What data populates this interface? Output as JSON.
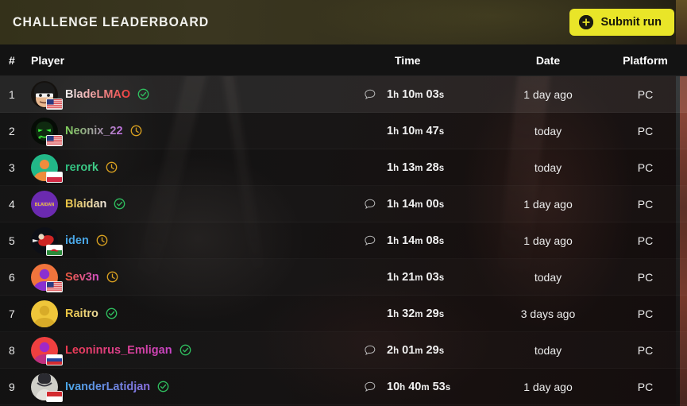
{
  "header": {
    "title": "CHALLENGE LEADERBOARD",
    "submit_label": "Submit run",
    "submit_icon": "plus-circle-icon",
    "accent_color": "#e9e528",
    "bar_background": "#35311c"
  },
  "columns": {
    "rank": "#",
    "player": "Player",
    "time": "Time",
    "date": "Date",
    "platform": "Platform"
  },
  "status_colors": {
    "verified": "#2fbf5f",
    "pending": "#d8a020"
  },
  "rows": [
    {
      "rank": "1",
      "player": "BladeLMAO",
      "name_gradient": [
        "#f2f2f2",
        "#ef3b3b"
      ],
      "status": "verified",
      "status_icon": "verified-check-icon",
      "flag": "us",
      "avatar_style": "photo-dark",
      "has_comment": true,
      "comment_icon": "comment-bubble-icon",
      "time": "1h 10m 03s",
      "date": "1 day ago",
      "platform": "PC",
      "highlighted": true
    },
    {
      "rank": "2",
      "player": "Neonix_22",
      "name_gradient": [
        "#7fcf5a",
        "#c06fe0"
      ],
      "status": "pending",
      "status_icon": "pending-clock-icon",
      "flag": "us",
      "avatar_style": "neon-green",
      "has_comment": false,
      "comment_icon": "",
      "time": "1h 10m 47s",
      "date": "today",
      "platform": "PC",
      "highlighted": false
    },
    {
      "rank": "3",
      "player": "rerork",
      "name_gradient": [
        "#2fbf7f",
        "#43d08a"
      ],
      "status": "pending",
      "status_icon": "pending-clock-icon",
      "flag": "pl",
      "avatar_style": "teal-person",
      "has_comment": false,
      "comment_icon": "",
      "time": "1h 13m 28s",
      "date": "today",
      "platform": "PC",
      "highlighted": false
    },
    {
      "rank": "4",
      "player": "Blaidan",
      "name_gradient": [
        "#e8c13c",
        "#f0e8e0"
      ],
      "status": "verified",
      "status_icon": "verified-check-icon",
      "flag": "",
      "avatar_style": "purple-logo",
      "has_comment": true,
      "comment_icon": "comment-bubble-icon",
      "time": "1h 14m 00s",
      "date": "1 day ago",
      "platform": "PC",
      "highlighted": false
    },
    {
      "rank": "5",
      "player": "iden",
      "name_gradient": [
        "#4aa8e8",
        "#4aa8e8"
      ],
      "status": "pending",
      "status_icon": "pending-clock-icon",
      "flag": "wales",
      "avatar_style": "dark-red-art",
      "has_comment": true,
      "comment_icon": "comment-bubble-icon",
      "time": "1h 14m 08s",
      "date": "1 day ago",
      "platform": "PC",
      "highlighted": false
    },
    {
      "rank": "6",
      "player": "Sev3n",
      "name_gradient": [
        "#ef5a3c",
        "#d050c8"
      ],
      "status": "pending",
      "status_icon": "pending-clock-icon",
      "flag": "us",
      "avatar_style": "orange-purple",
      "has_comment": false,
      "comment_icon": "",
      "time": "1h 21m 03s",
      "date": "today",
      "platform": "PC",
      "highlighted": false
    },
    {
      "rank": "7",
      "player": "Raitro",
      "name_gradient": [
        "#e8c13c",
        "#f0dfa0"
      ],
      "status": "verified",
      "status_icon": "verified-check-icon",
      "flag": "",
      "avatar_style": "gold-person",
      "has_comment": false,
      "comment_icon": "",
      "time": "1h 32m 29s",
      "date": "3 days ago",
      "platform": "PC",
      "highlighted": false
    },
    {
      "rank": "8",
      "player": "Leoninrus_Emligan",
      "name_gradient": [
        "#ef3b4f",
        "#c845c8"
      ],
      "status": "verified",
      "status_icon": "verified-check-icon",
      "flag": "ru",
      "avatar_style": "red-purple",
      "has_comment": true,
      "comment_icon": "comment-bubble-icon",
      "time": "2h 01m 29s",
      "date": "today",
      "platform": "PC",
      "highlighted": false
    },
    {
      "rank": "9",
      "player": "IvanderLatidjan",
      "name_gradient": [
        "#4aa8e8",
        "#8a6fe0"
      ],
      "status": "verified",
      "status_icon": "verified-check-icon",
      "flag": "id",
      "avatar_style": "grey-photo",
      "has_comment": true,
      "comment_icon": "comment-bubble-icon",
      "time": "10h 40m 53s",
      "date": "1 day ago",
      "platform": "PC",
      "highlighted": false
    }
  ]
}
